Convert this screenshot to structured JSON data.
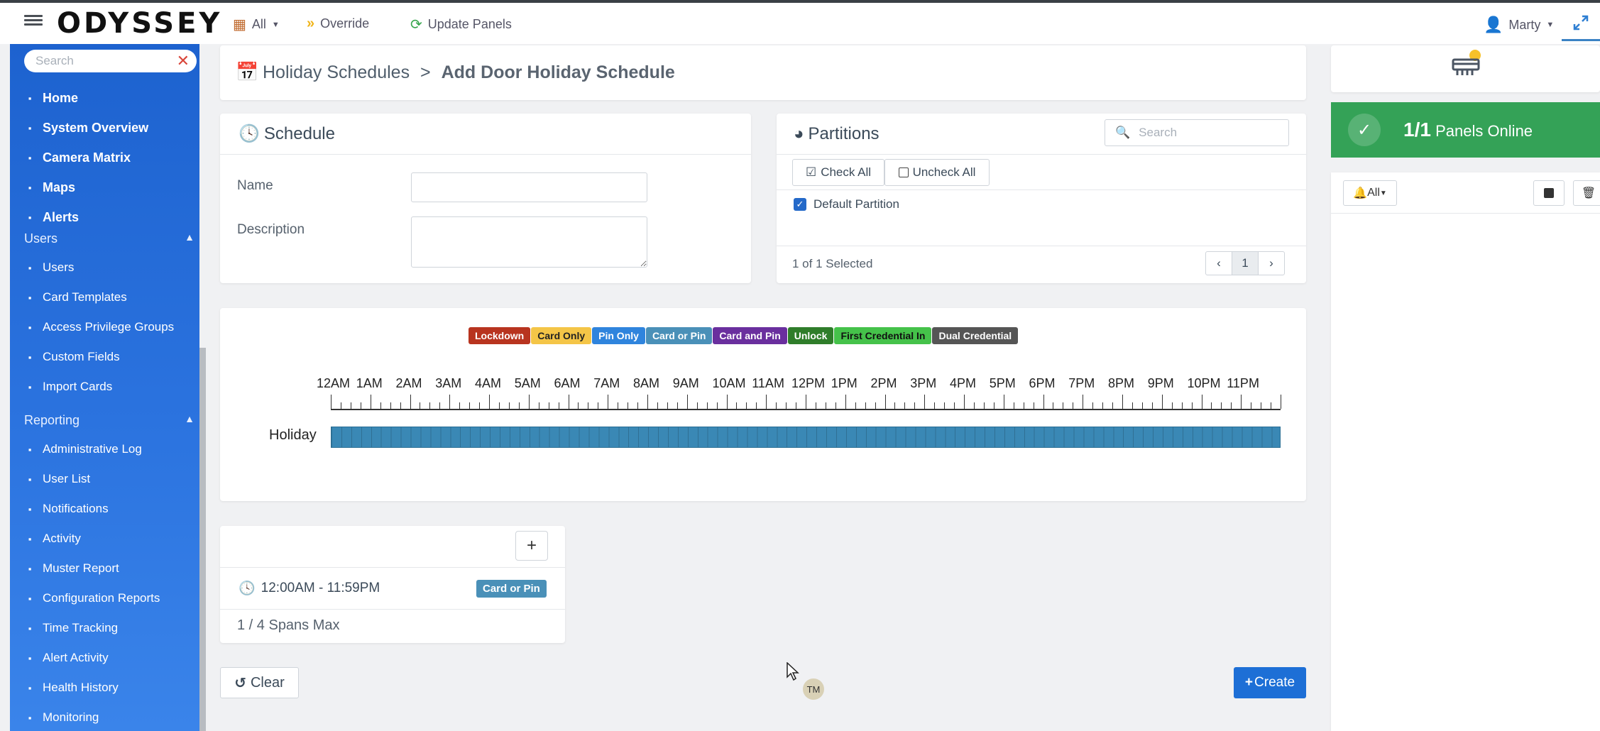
{
  "app": {
    "logo": "ODYSSEY"
  },
  "toolbar": {
    "site_label": "All",
    "override_label": "Override",
    "update_label": "Update Panels",
    "user_name": "Marty"
  },
  "sidebar": {
    "search_placeholder": "Search",
    "main_items": [
      {
        "label": "Home",
        "icon": "home-icon"
      },
      {
        "label": "System Overview",
        "icon": "overview-icon"
      },
      {
        "label": "Camera Matrix",
        "icon": "camera-icon"
      },
      {
        "label": "Maps",
        "icon": "map-icon"
      },
      {
        "label": "Alerts",
        "icon": "bell-icon"
      }
    ],
    "users_section": "Users",
    "users_items": [
      {
        "label": "Users",
        "icon": "users-icon"
      },
      {
        "label": "Card Templates",
        "icon": "card-icon"
      },
      {
        "label": "Access Privilege Groups",
        "icon": "privilege-icon"
      },
      {
        "label": "Custom Fields",
        "icon": "field-icon"
      },
      {
        "label": "Import Cards",
        "icon": "import-icon"
      }
    ],
    "reporting_section": "Reporting",
    "reporting_items": [
      {
        "label": "Administrative Log",
        "icon": "list-icon"
      },
      {
        "label": "User List",
        "icon": "list-icon"
      },
      {
        "label": "Notifications",
        "icon": "bell-icon"
      },
      {
        "label": "Activity",
        "icon": "activity-icon"
      },
      {
        "label": "Muster Report",
        "icon": "report-icon"
      },
      {
        "label": "Configuration Reports",
        "icon": "config-icon"
      },
      {
        "label": "Time Tracking",
        "icon": "list-icon"
      },
      {
        "label": "Alert Activity",
        "icon": "alert-icon"
      },
      {
        "label": "Health History",
        "icon": "health-icon"
      },
      {
        "label": "Monitoring",
        "icon": "monitor-icon"
      }
    ]
  },
  "breadcrumb": {
    "parent": "Holiday Schedules",
    "separator": ">",
    "current": "Add Door Holiday Schedule"
  },
  "schedule": {
    "title": "Schedule",
    "name_label": "Name",
    "name_value": "",
    "description_label": "Description",
    "description_value": ""
  },
  "partitions": {
    "title": "Partitions",
    "search_placeholder": "Search",
    "check_all": "Check All",
    "uncheck_all": "Uncheck All",
    "items": [
      {
        "label": "Default Partition",
        "checked": true
      }
    ],
    "selected_text": "1 of 1 Selected",
    "page": "1"
  },
  "timeline": {
    "legend": [
      {
        "label": "Lockdown",
        "color": "#b8341f",
        "text": "#ffffff"
      },
      {
        "label": "Card Only",
        "color": "#f4c547",
        "text": "#222222"
      },
      {
        "label": "Pin Only",
        "color": "#2f84dd",
        "text": "#ffffff"
      },
      {
        "label": "Card or Pin",
        "color": "#4a90b8",
        "text": "#ffffff"
      },
      {
        "label": "Card and Pin",
        "color": "#6a2f9e",
        "text": "#ffffff"
      },
      {
        "label": "Unlock",
        "color": "#2f7d2a",
        "text": "#ffffff"
      },
      {
        "label": "First Credential In",
        "color": "#45c24a",
        "text": "#111111"
      },
      {
        "label": "Dual Credential",
        "color": "#555555",
        "text": "#ffffff"
      }
    ],
    "hours": [
      "12AM",
      "1AM",
      "2AM",
      "3AM",
      "4AM",
      "5AM",
      "6AM",
      "7AM",
      "8AM",
      "9AM",
      "10AM",
      "11AM",
      "12PM",
      "1PM",
      "2PM",
      "3PM",
      "4PM",
      "5PM",
      "6PM",
      "7PM",
      "8PM",
      "9PM",
      "10PM",
      "11PM"
    ],
    "row_label": "Holiday"
  },
  "spans": {
    "time": "12:00AM - 11:59PM",
    "mode": "Card or Pin",
    "max_text": "1 / 4 Spans Max"
  },
  "actions": {
    "clear": "Clear",
    "create": "Create"
  },
  "avatar_initials": "TM",
  "right_panel": {
    "online_count": "1/1",
    "online_label": "Panels Online",
    "filter_label": "All"
  }
}
